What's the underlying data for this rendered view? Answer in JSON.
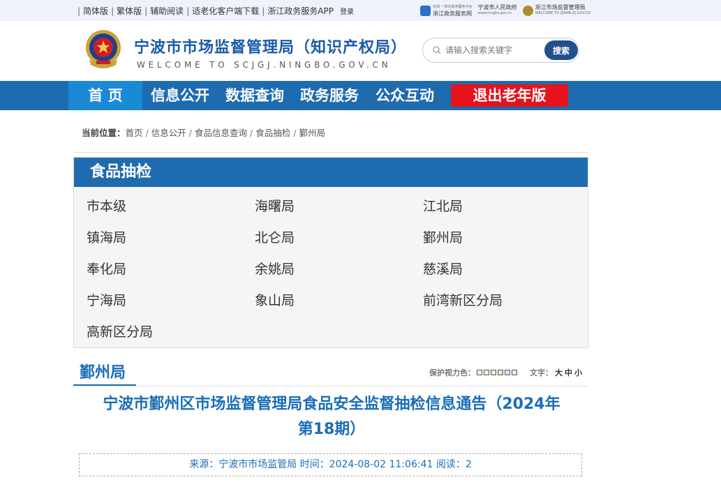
{
  "topbar": {
    "links": [
      "简体版",
      "繁体版",
      "辅助阅读",
      "适老化客户端下载",
      "浙江政务服务APP"
    ],
    "login": "登录",
    "portals": [
      {
        "title": "浙江政务服务网",
        "sub": "在线 一体化政务服务平台",
        "color": "#2d6fc4"
      },
      {
        "title": "宁波市人民政府",
        "sub": "www.ningbo.gov.cn",
        "color": "#c0392b"
      },
      {
        "title": "浙江市场监督管理局",
        "sub": "WELCOME TO ZJAMR.ZJ.GOV.CN",
        "color": "#b08a2e"
      }
    ]
  },
  "header": {
    "title": "宁波市市场监督管理局（知识产权局）",
    "subtitle": "WELCOME TO SCJGJ.NINGBO.GOV.CN",
    "search": {
      "placeholder": "请输入搜索关键字",
      "button": "搜索"
    }
  },
  "nav": {
    "items": [
      "首 页",
      "信息公开",
      "数据查询",
      "政务服务",
      "公众互动"
    ],
    "exit": "退出老年版"
  },
  "breadcrumb": {
    "label": "当前位置：",
    "items": [
      "首页",
      "信息公开",
      "食品信息查询",
      "食品抽检",
      "鄞州局"
    ]
  },
  "category": {
    "title": "食品抽检",
    "items": [
      "市本级",
      "海曙局",
      "江北局",
      "镇海局",
      "北仑局",
      "鄞州局",
      "奉化局",
      "余姚局",
      "慈溪局",
      "宁海局",
      "象山局",
      "前湾新区分局",
      "高新区分局"
    ]
  },
  "article": {
    "section": "鄞州局",
    "eye_care_label": "保护视力色：",
    "eye_colors": [
      "#faf9de",
      "#fff2e2",
      "#fde6e0",
      "#e3edcd",
      "#dce2f1",
      "#e9ebfe"
    ],
    "text_size_label": "文字：",
    "text_sizes": [
      "大",
      "中",
      "小"
    ],
    "title_line1": "宁波市鄞州区市场监督管理局食品安全监督抽检信息通告（2024年",
    "title_line2": "第18期）",
    "meta": "来源：宁波市市场监管局 时间：2024-08-02 11:06:41 阅读：2"
  }
}
